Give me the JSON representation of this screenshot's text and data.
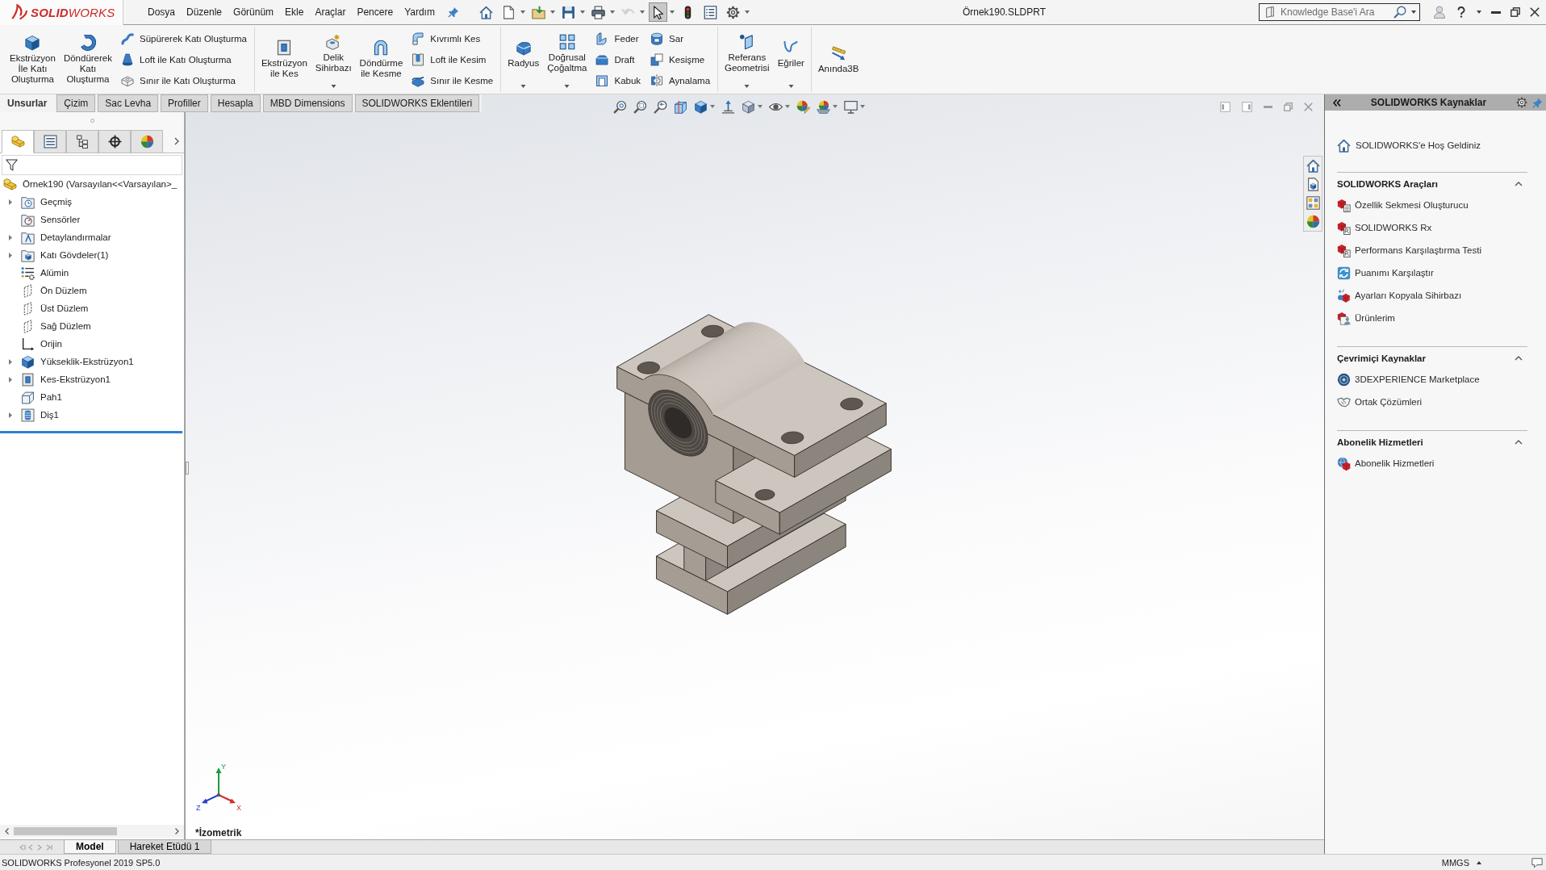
{
  "title_bar": {
    "logo": "**SOLID**WORKS",
    "menu": [
      "Dosya",
      "Düzenle",
      "Görünüm",
      "Ekle",
      "Araçlar",
      "Pencere",
      "Yardım"
    ],
    "quick_access": [
      {
        "kind": "home",
        "dropdown": false,
        "pressed": false,
        "disabled": false
      },
      {
        "kind": "new",
        "dropdown": true,
        "pressed": false,
        "disabled": false
      },
      {
        "kind": "open",
        "dropdown": true,
        "pressed": false,
        "disabled": false
      },
      {
        "kind": "save",
        "dropdown": true,
        "pressed": false,
        "disabled": false
      },
      {
        "kind": "print",
        "dropdown": true,
        "pressed": false,
        "disabled": false
      },
      {
        "kind": "undo",
        "dropdown": true,
        "pressed": false,
        "disabled": true
      },
      {
        "kind": "select",
        "dropdown": true,
        "pressed": true,
        "disabled": false
      },
      {
        "kind": "rebuild",
        "dropdown": false,
        "pressed": false,
        "disabled": false
      },
      {
        "kind": "properties",
        "dropdown": false,
        "pressed": false,
        "disabled": false
      },
      {
        "kind": "options",
        "dropdown": true,
        "pressed": false,
        "disabled": false
      }
    ],
    "document_title": "Örnek190.SLDPRT",
    "search": {
      "placeholder": "Knowledge Base'i Ara"
    }
  },
  "ribbon": {
    "groups": [
      {
        "columns": [
          {
            "kind": "large",
            "items": [
              {
                "kind": "extrude",
                "label": "Ekstrüzyon\nİle Katı\nOluşturma",
                "dropdown": false
              }
            ]
          },
          {
            "kind": "large",
            "items": [
              {
                "kind": "revolve",
                "label": "Döndürerek\nKatı\nOluşturma",
                "dropdown": false
              }
            ]
          },
          {
            "kind": "stack",
            "items": [
              {
                "kind": "sweep",
                "label": "Süpürerek Katı Oluşturma",
                "dropdown": false
              },
              {
                "kind": "loft",
                "label": "Loft ile Katı Oluşturma",
                "dropdown": false
              },
              {
                "kind": "boundary",
                "label": "Sınır ile Katı Oluşturma",
                "dropdown": false
              }
            ]
          }
        ]
      },
      {
        "columns": [
          {
            "kind": "large",
            "items": [
              {
                "kind": "extrudecut",
                "label": "Ekstrüzyon\nile Kes",
                "dropdown": false
              }
            ]
          },
          {
            "kind": "large",
            "items": [
              {
                "kind": "hole",
                "label": "Delik\nSihirbazı",
                "dropdown": true
              }
            ]
          },
          {
            "kind": "large",
            "items": [
              {
                "kind": "revolvecut",
                "label": "Döndürme\nile Kesme",
                "dropdown": false
              }
            ]
          },
          {
            "kind": "stack",
            "items": [
              {
                "kind": "sweptcut",
                "label": "Kıvrımlı Kes",
                "dropdown": false
              },
              {
                "kind": "loftcut",
                "label": "Loft ile Kesim",
                "dropdown": false
              },
              {
                "kind": "boundarycut",
                "label": "Sınır ile Kesme",
                "dropdown": false
              }
            ]
          }
        ]
      },
      {
        "columns": [
          {
            "kind": "large",
            "items": [
              {
                "kind": "fillet",
                "label": "Radyus",
                "dropdown": true
              }
            ]
          },
          {
            "kind": "large",
            "items": [
              {
                "kind": "pattern",
                "label": "Doğrusal\nÇoğaltma",
                "dropdown": true
              }
            ]
          },
          {
            "kind": "stack",
            "items": [
              {
                "kind": "rib",
                "label": "Feder",
                "dropdown": false
              },
              {
                "kind": "draft",
                "label": "Draft",
                "dropdown": false
              },
              {
                "kind": "shell",
                "label": "Kabuk",
                "dropdown": false
              }
            ]
          },
          {
            "kind": "stack",
            "items": [
              {
                "kind": "wrap",
                "label": "Sar",
                "dropdown": false
              },
              {
                "kind": "intersect",
                "label": "Kesişme",
                "dropdown": false
              },
              {
                "kind": "mirror",
                "label": "Aynalama",
                "dropdown": false
              }
            ]
          }
        ]
      },
      {
        "columns": [
          {
            "kind": "large",
            "items": [
              {
                "kind": "refgeom",
                "label": "Referans\nGeometrisi",
                "dropdown": true
              }
            ]
          },
          {
            "kind": "large",
            "items": [
              {
                "kind": "curves",
                "label": "Eğriler",
                "dropdown": true
              }
            ]
          }
        ]
      },
      {
        "columns": [
          {
            "kind": "large",
            "items": [
              {
                "kind": "instant3d",
                "label": "Anında3B",
                "dropdown": false
              }
            ]
          }
        ]
      }
    ]
  },
  "command_tabs": [
    {
      "label": "Unsurlar",
      "selected": true
    },
    {
      "label": "Çizim",
      "selected": false
    },
    {
      "label": "Sac Levha",
      "selected": false
    },
    {
      "label": "Profiller",
      "selected": false
    },
    {
      "label": "Hesapla",
      "selected": false
    },
    {
      "label": "MBD Dimensions",
      "selected": false
    },
    {
      "label": "SOLIDWORKS Eklentileri",
      "selected": false
    }
  ],
  "feature_manager": {
    "panel_tabs": [
      {
        "kind": "features",
        "selected": true
      },
      {
        "kind": "properties",
        "selected": false
      },
      {
        "kind": "configurations",
        "selected": false
      },
      {
        "kind": "dimxpert",
        "selected": false
      },
      {
        "kind": "display",
        "selected": false
      }
    ],
    "tree": [
      {
        "kind": "part",
        "label": "Örnek190 (Varsayılan<<Varsayılan>_",
        "children": [
          {
            "kind": "history",
            "label": "Geçmiş",
            "expanded": false
          },
          {
            "kind": "sensors",
            "label": "Sensörler"
          },
          {
            "kind": "annotations",
            "label": "Detaylandırmalar",
            "expanded": false
          },
          {
            "kind": "bodies",
            "label": "Katı Gövdeler(1)",
            "expanded": false
          },
          {
            "kind": "material",
            "label": "Alümin"
          },
          {
            "kind": "plane",
            "label": "Ön Düzlem"
          },
          {
            "kind": "plane",
            "label": "Üst Düzlem"
          },
          {
            "kind": "plane",
            "label": "Sağ Düzlem"
          },
          {
            "kind": "origin",
            "label": "Orijin"
          },
          {
            "kind": "boss",
            "label": "Yükseklik-Ekstrüzyon1",
            "expanded": false
          },
          {
            "kind": "cut",
            "label": "Kes-Ekstrüzyon1",
            "expanded": false
          },
          {
            "kind": "chamfer",
            "label": "Pah1"
          },
          {
            "kind": "thread",
            "label": "Diş1",
            "expanded": false
          }
        ]
      }
    ]
  },
  "graphics": {
    "view_name": "*İzometrik",
    "triad": {
      "x": "X",
      "y": "Y",
      "z": "Z"
    }
  },
  "task_pane": {
    "title": "SOLIDWORKS Kaynaklar",
    "welcome": "SOLIDWORKS'e Hoş Geldiniz",
    "sections": [
      {
        "title": "SOLIDWORKS Araçları",
        "expanded": true,
        "items": [
          {
            "kind": "sheet",
            "label": "Özellik Sekmesi Oluşturucu"
          },
          {
            "kind": "rx",
            "label": "SOLIDWORKS Rx"
          },
          {
            "kind": "rx",
            "label": "Performans Karşılaştırma Testi"
          },
          {
            "kind": "compare",
            "label": "Puanımı Karşılaştır"
          },
          {
            "kind": "copy",
            "label": "Ayarları Kopyala Sihirbazı"
          },
          {
            "kind": "products",
            "label": "Ürünlerim"
          }
        ]
      },
      {
        "title": "Çevrimiçi Kaynaklar",
        "expanded": true,
        "items": [
          {
            "kind": "marketplace",
            "label": "3DEXPERIENCE Marketplace"
          },
          {
            "kind": "partners",
            "label": "Ortak Çözümleri"
          }
        ]
      },
      {
        "title": "Abonelik Hizmetleri",
        "expanded": true,
        "items": [
          {
            "kind": "subscription",
            "label": "Abonelik Hizmetleri"
          }
        ]
      }
    ]
  },
  "bottom_tabs": [
    {
      "label": "Model",
      "selected": true
    },
    {
      "label": "Hareket Etüdü 1",
      "selected": false
    }
  ],
  "status_bar": {
    "text": "SOLIDWORKS Profesyonel 2019 SP5.0",
    "units": "MMGS"
  }
}
